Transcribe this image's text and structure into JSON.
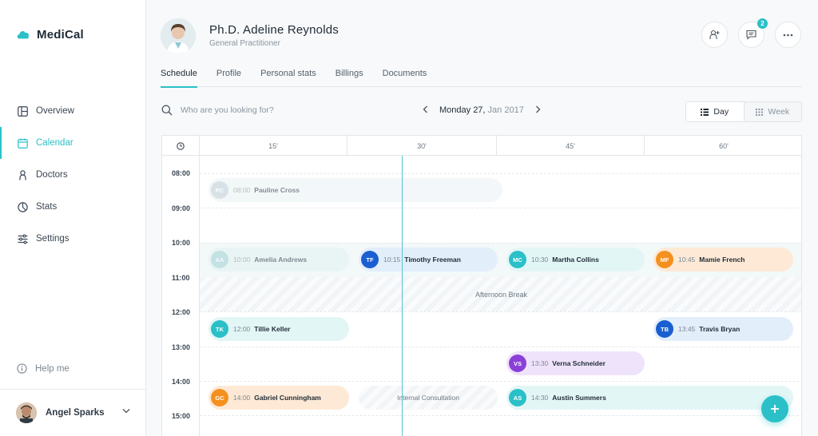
{
  "app": {
    "name": "MediCal",
    "brand_color": "#2bc0c8"
  },
  "sidebar": {
    "items": [
      {
        "label": "Overview",
        "icon": "layout-icon",
        "active": false
      },
      {
        "label": "Calendar",
        "icon": "calendar-icon",
        "active": true
      },
      {
        "label": "Doctors",
        "icon": "person-icon",
        "active": false
      },
      {
        "label": "Stats",
        "icon": "pie-chart-icon",
        "active": false
      },
      {
        "label": "Settings",
        "icon": "sliders-icon",
        "active": false
      }
    ],
    "help": "Help me",
    "user": {
      "name": "Angel Sparks"
    }
  },
  "header": {
    "doctor_name": "Ph.D. Adeline Reynolds",
    "doctor_role": "General Practitioner",
    "messages_badge": "2"
  },
  "tabs": [
    "Schedule",
    "Profile",
    "Personal stats",
    "Billings",
    "Documents"
  ],
  "toolbar": {
    "search_placeholder": "Who are you looking for?",
    "date_main": "Monday 27,",
    "date_sub": "Jan 2017",
    "view_day": "Day",
    "view_week": "Week"
  },
  "grid": {
    "columns": [
      "15'",
      "30'",
      "45'",
      "60'"
    ],
    "times": [
      "08:00",
      "09:00",
      "10:00",
      "11:00",
      "12:00",
      "13:00",
      "14:00",
      "15:00"
    ],
    "break_label": "Afternoon Break",
    "internal_label": "Internal Consultation"
  },
  "appointments": [
    {
      "initials": "PC",
      "time": "08:00",
      "name": "Pauline Cross",
      "color": "#b7c9d3",
      "bg": "#e9f1f4",
      "faded": true
    },
    {
      "initials": "AA",
      "time": "10:00",
      "name": "Amelia Andrews",
      "color": "#9fd0d4",
      "bg": "#e1f1f2",
      "faded": true
    },
    {
      "initials": "TF",
      "time": "10:15",
      "name": "Timothy Freeman",
      "color": "#1a5fd1",
      "bg": "#e3eefb",
      "faded": false
    },
    {
      "initials": "MC",
      "time": "10:30",
      "name": "Martha Collins",
      "color": "#2bc0c8",
      "bg": "#e3f6f6",
      "faded": false
    },
    {
      "initials": "MF",
      "time": "10:45",
      "name": "Mamie French",
      "color": "#f5901e",
      "bg": "#fde9d6",
      "faded": false
    },
    {
      "initials": "TK",
      "time": "12:00",
      "name": "Tillie Keller",
      "color": "#2bc0c8",
      "bg": "#e3f6f6",
      "faded": false
    },
    {
      "initials": "TB",
      "time": "13:45",
      "name": "Travis Bryan",
      "color": "#1a5fd1",
      "bg": "#e3eefb",
      "faded": false
    },
    {
      "initials": "VS",
      "time": "13:30",
      "name": "Verna Schneider",
      "color": "#8a3fd8",
      "bg": "#efe3fb",
      "faded": false
    },
    {
      "initials": "GC",
      "time": "14:00",
      "name": "Gabriel Cunningham",
      "color": "#f5901e",
      "bg": "#fde9d6",
      "faded": false
    },
    {
      "initials": "AS",
      "time": "14:30",
      "name": "Austin Summers",
      "color": "#2bc0c8",
      "bg": "#e3f6f6",
      "faded": false
    }
  ]
}
